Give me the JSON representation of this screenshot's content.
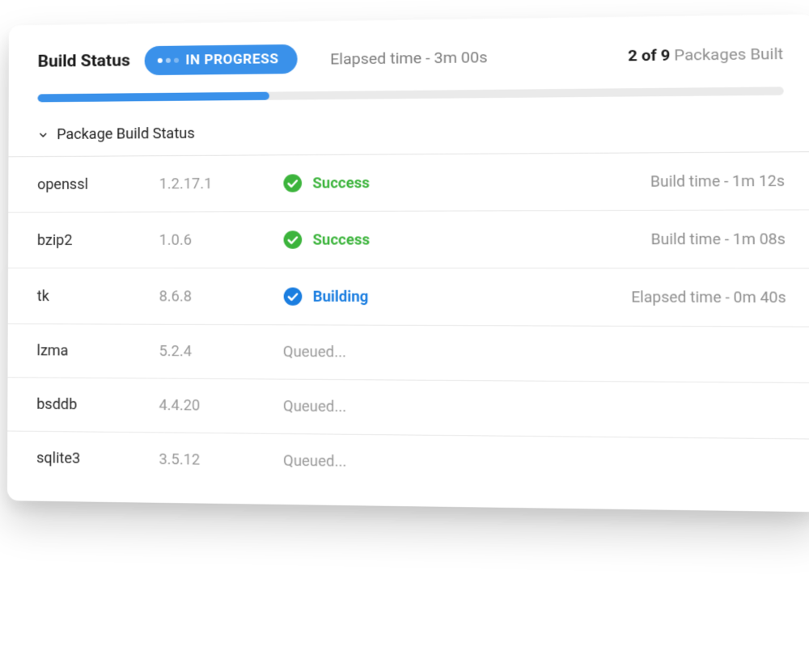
{
  "header": {
    "title": "Build Status",
    "status_label": "IN PROGRESS",
    "elapsed_label": "Elapsed time - 3m 00s",
    "packages_built_count": "2 of 9",
    "packages_built_label": "Packages Built"
  },
  "progress": {
    "percent": 32
  },
  "section": {
    "title": "Package Build Status"
  },
  "packages": [
    {
      "name": "openssl",
      "version": "1.2.17.1",
      "status": "success",
      "status_label": "Success",
      "time_label": "Build time - 1m 12s"
    },
    {
      "name": "bzip2",
      "version": "1.0.6",
      "status": "success",
      "status_label": "Success",
      "time_label": "Build time - 1m 08s"
    },
    {
      "name": "tk",
      "version": "8.6.8",
      "status": "building",
      "status_label": "Building",
      "time_label": "Elapsed time - 0m 40s"
    },
    {
      "name": "lzma",
      "version": "5.2.4",
      "status": "queued",
      "status_label": "Queued...",
      "time_label": ""
    },
    {
      "name": "bsddb",
      "version": "4.4.20",
      "status": "queued",
      "status_label": "Queued...",
      "time_label": ""
    },
    {
      "name": "sqlite3",
      "version": "3.5.12",
      "status": "queued",
      "status_label": "Queued...",
      "time_label": ""
    }
  ],
  "colors": {
    "accent": "#3a91ea",
    "success": "#3cb43c",
    "muted": "#9a9a9a"
  }
}
